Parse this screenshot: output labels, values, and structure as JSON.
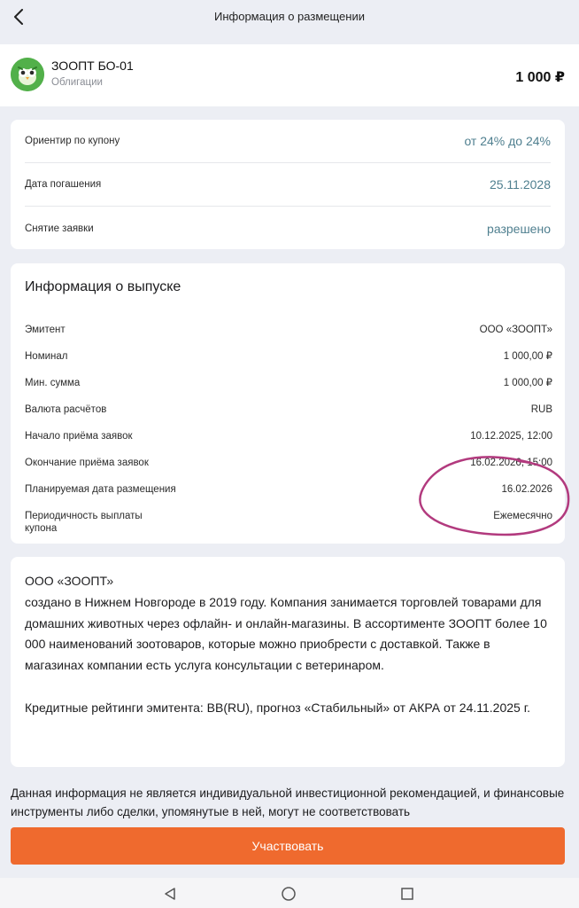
{
  "header": {
    "title": "Информация о размещении"
  },
  "bond": {
    "name": "ЗООПТ БО-01",
    "type": "Облигации",
    "price": "1 000 ₽"
  },
  "summary": [
    {
      "label": "Ориентир по купону",
      "value": "от 24% до 24%"
    },
    {
      "label": "Дата погашения",
      "value": "25.11.2028"
    },
    {
      "label": "Снятие заявки",
      "value": "разрешено"
    }
  ],
  "issue": {
    "title": "Информация о выпуске",
    "rows": [
      {
        "label": "Эмитент",
        "value": "ООО «ЗООПТ»"
      },
      {
        "label": "Номинал",
        "value": "1 000,00 ₽"
      },
      {
        "label": "Мин. сумма",
        "value": "1 000,00 ₽"
      },
      {
        "label": "Валюта расчётов",
        "value": "RUB"
      },
      {
        "label": "Начало приёма заявок",
        "value": "10.12.2025, 12:00"
      },
      {
        "label": "Окончание приёма заявок",
        "value": "16.02.2026, 15:00"
      },
      {
        "label": "Планируемая дата размещения",
        "value": "16.02.2026"
      },
      {
        "label": "Периодичность выплаты купона",
        "value": "Ежемесячно"
      }
    ]
  },
  "about": {
    "company": "ООО «ЗООПТ»",
    "description": "создано в Нижнем Новгороде в 2019 году. Компания занимается торговлей товарами для домашних животных через офлайн- и онлайн-магазины. В ассортименте ЗООПТ более 10 000 наименований зоотоваров, которые можно приобрести с доставкой. Также в магазинах компании есть услуга консультации с ветеринаром.",
    "rating": "Кредитные рейтинги эмитента: BB(RU), прогноз «Стабильный» от АКРА от 24.11.2025 г."
  },
  "disclaimer": "Данная информация не является индивидуальной инвестиционной рекомендацией, и финансовые инструменты либо сделки, упомянутые в ней, могут не соответствовать",
  "actions": {
    "participate_label": "Участвовать"
  },
  "colors": {
    "accent": "#ef6a2e",
    "value_text": "#4f7f8f",
    "annotation": "#b23a7e",
    "logo": "#52b04a"
  },
  "icons": [
    "back-arrow-icon",
    "zoopt-logo",
    "nav-back-icon",
    "nav-home-icon",
    "nav-recents-icon"
  ]
}
